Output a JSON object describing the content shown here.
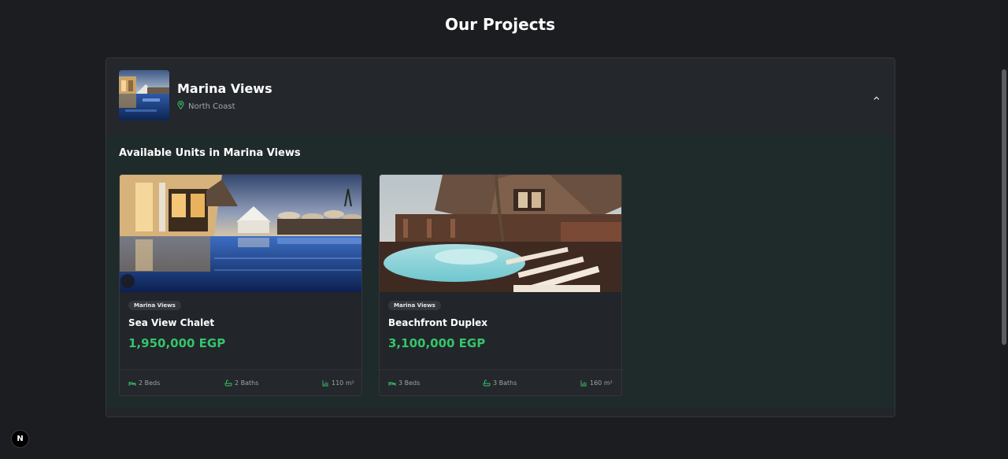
{
  "page": {
    "title": "Our Projects"
  },
  "project": {
    "name": "Marina Views",
    "location": "North Coast",
    "units_heading": "Available Units in Marina Views",
    "units": [
      {
        "project_tag": "Marina Views",
        "title": "Sea View Chalet",
        "price": "1,950,000 EGP",
        "beds": "2 Beds",
        "baths": "2 Baths",
        "area": "110 m²"
      },
      {
        "project_tag": "Marina Views",
        "title": "Beachfront Duplex",
        "price": "3,100,000 EGP",
        "beds": "3 Beds",
        "baths": "3 Baths",
        "area": "160 m²"
      }
    ]
  },
  "next_badge": "N",
  "colors": {
    "accent": "#35c46b",
    "background": "#1c1d21",
    "panel": "#22252a",
    "units_bg": "#1f2a2a"
  },
  "icons": [
    "location-pin-icon",
    "chevron-up-icon",
    "bed-icon",
    "bath-icon",
    "area-chart-icon"
  ]
}
